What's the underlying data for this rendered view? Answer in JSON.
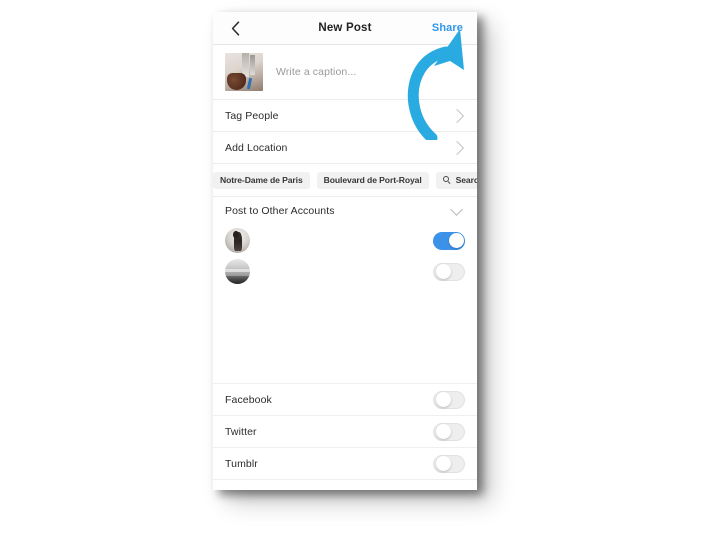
{
  "screen": {
    "nav": {
      "back_icon": "chevron-left-icon",
      "title": "New Post",
      "share_label": "Share"
    },
    "caption": {
      "thumbnail_icon": "photo-thumbnail",
      "placeholder": "Write a caption..."
    },
    "rows": [
      {
        "label": "Tag People",
        "chevron_icon": "chevron-right-icon"
      },
      {
        "label": "Add Location",
        "chevron_icon": "chevron-right-icon"
      }
    ],
    "location_chips": [
      {
        "label": "Notre-Dame de Paris",
        "partial": true
      },
      {
        "label": "Boulevard de Port-Royal",
        "partial": false
      }
    ],
    "search_chip": {
      "label": "Search",
      "icon": "search-icon"
    },
    "accounts_section": {
      "title": "Post to Other Accounts",
      "collapse_icon": "chevron-down-icon",
      "accounts": [
        {
          "avatar_icon": "avatar-person",
          "enabled": true,
          "state": "on"
        },
        {
          "avatar_icon": "avatar-landscape",
          "enabled": false,
          "state": "off"
        }
      ]
    },
    "social_rows": [
      {
        "label": "Facebook",
        "state": "off"
      },
      {
        "label": "Twitter",
        "state": "off"
      },
      {
        "label": "Tumblr",
        "state": "off"
      }
    ]
  },
  "annotation": {
    "arrow_icon": "curved-arrow-up-right",
    "color": "#29ABE2",
    "points_to": "Share"
  },
  "colors": {
    "share_blue": "#2F96E8",
    "toggle_on": "#3C92E8",
    "toggle_off": "#EEEEEE",
    "chip_bg": "#F1F1F1",
    "text_primary": "#2B2B2B",
    "text_placeholder": "#9A9A9A",
    "arrow": "#29ABE2",
    "page_bg": "#FFFFFF"
  }
}
